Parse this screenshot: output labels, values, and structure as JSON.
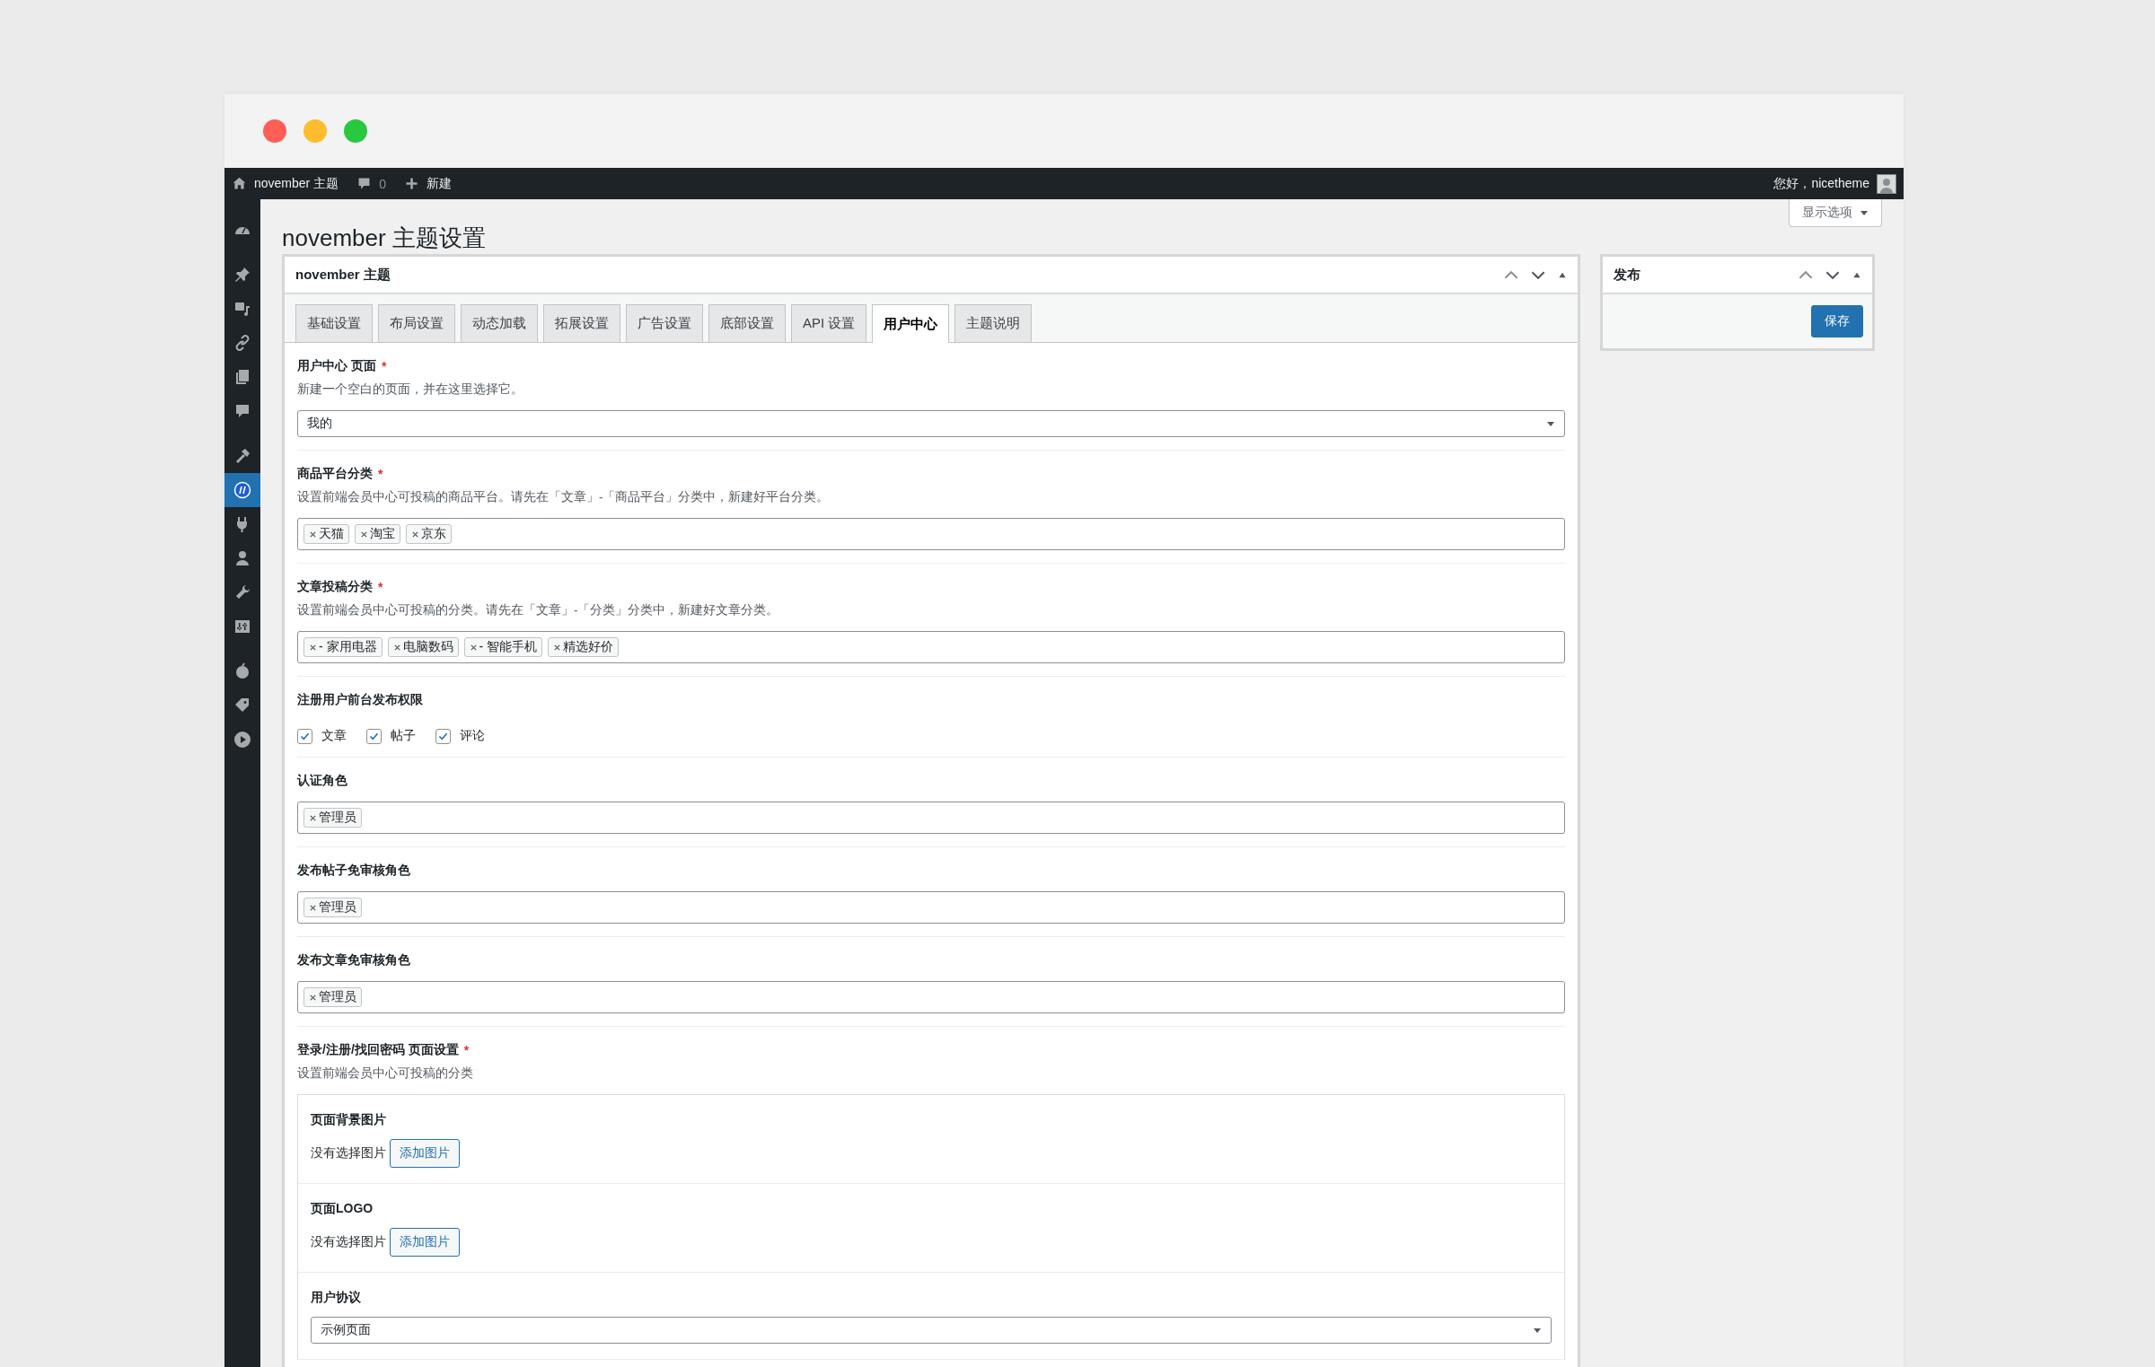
{
  "admin_bar": {
    "site": "november 主题",
    "comments": "0",
    "new": "新建",
    "greeting": "您好，nicetheme"
  },
  "sidebar": {
    "groups": [
      {
        "items": [
          {
            "kind": "dashboard",
            "selected": false
          }
        ]
      },
      {
        "items": [
          {
            "kind": "pin",
            "selected": false
          },
          {
            "kind": "media",
            "selected": false
          },
          {
            "kind": "link",
            "selected": false
          },
          {
            "kind": "pages",
            "selected": false
          },
          {
            "kind": "comment",
            "selected": false
          }
        ]
      },
      {
        "items": [
          {
            "kind": "hammer",
            "selected": false
          },
          {
            "kind": "logo",
            "selected": true
          },
          {
            "kind": "plugin",
            "selected": false
          },
          {
            "kind": "user",
            "selected": false
          },
          {
            "kind": "wrench",
            "selected": false
          },
          {
            "kind": "sliders",
            "selected": false
          }
        ]
      },
      {
        "items": [
          {
            "kind": "fruit",
            "selected": false
          },
          {
            "kind": "tag",
            "selected": false
          },
          {
            "kind": "play",
            "selected": false
          }
        ]
      }
    ]
  },
  "screen_options": "显示选项",
  "page_title": "november 主题设置",
  "main_box": {
    "title": "november 主题",
    "tabs": [
      {
        "label": "基础设置",
        "selected": false
      },
      {
        "label": "布局设置",
        "selected": false
      },
      {
        "label": "动态加载",
        "selected": false
      },
      {
        "label": "拓展设置",
        "selected": false
      },
      {
        "label": "广告设置",
        "selected": false
      },
      {
        "label": "底部设置",
        "selected": false
      },
      {
        "label": "API 设置",
        "selected": false
      },
      {
        "label": "用户中心",
        "selected": true
      },
      {
        "label": "主题说明",
        "selected": false
      }
    ],
    "fields": [
      {
        "kind": "select",
        "label": "用户中心 页面",
        "required_mark": "*",
        "description": "新建一个空白的页面，并在这里选择它。",
        "value": "我的"
      },
      {
        "kind": "tags",
        "label": "商品平台分类",
        "required_mark": "*",
        "description": "设置前端会员中心可投稿的商品平台。请先在「文章」-「商品平台」分类中，新建好平台分类。",
        "tags": [
          "天猫",
          "淘宝",
          "京东"
        ]
      },
      {
        "kind": "tags",
        "label": "文章投稿分类",
        "required_mark": "*",
        "description": "设置前端会员中心可投稿的分类。请先在「文章」-「分类」分类中，新建好文章分类。",
        "tags": [
          "- 家用电器",
          "电脑数码",
          "- 智能手机",
          "精选好价"
        ]
      },
      {
        "kind": "checkboxes",
        "label": "注册用户前台发布权限",
        "options": [
          {
            "label": "文章",
            "checked": true
          },
          {
            "label": "帖子",
            "checked": true
          },
          {
            "label": "评论",
            "checked": true
          }
        ]
      },
      {
        "kind": "tags",
        "label": "认证角色",
        "tags": [
          "管理员"
        ]
      },
      {
        "kind": "tags",
        "label": "发布帖子免审核角色",
        "tags": [
          "管理员"
        ]
      },
      {
        "kind": "tags",
        "label": "发布文章免审核角色",
        "tags": [
          "管理员"
        ]
      },
      {
        "kind": "group",
        "label": "登录/注册/找回密码 页面设置",
        "required_mark": "*",
        "description": "设置前端会员中心可投稿的分类",
        "items": [
          {
            "kind": "media",
            "label": "页面背景图片",
            "status": "没有选择图片",
            "button": "添加图片"
          },
          {
            "kind": "media",
            "label": "页面LOGO",
            "status": "没有选择图片",
            "button": "添加图片"
          },
          {
            "kind": "select",
            "label": "用户协议",
            "value": "示例页面"
          }
        ]
      }
    ]
  },
  "publish_box": {
    "title": "发布",
    "button": "保存"
  }
}
